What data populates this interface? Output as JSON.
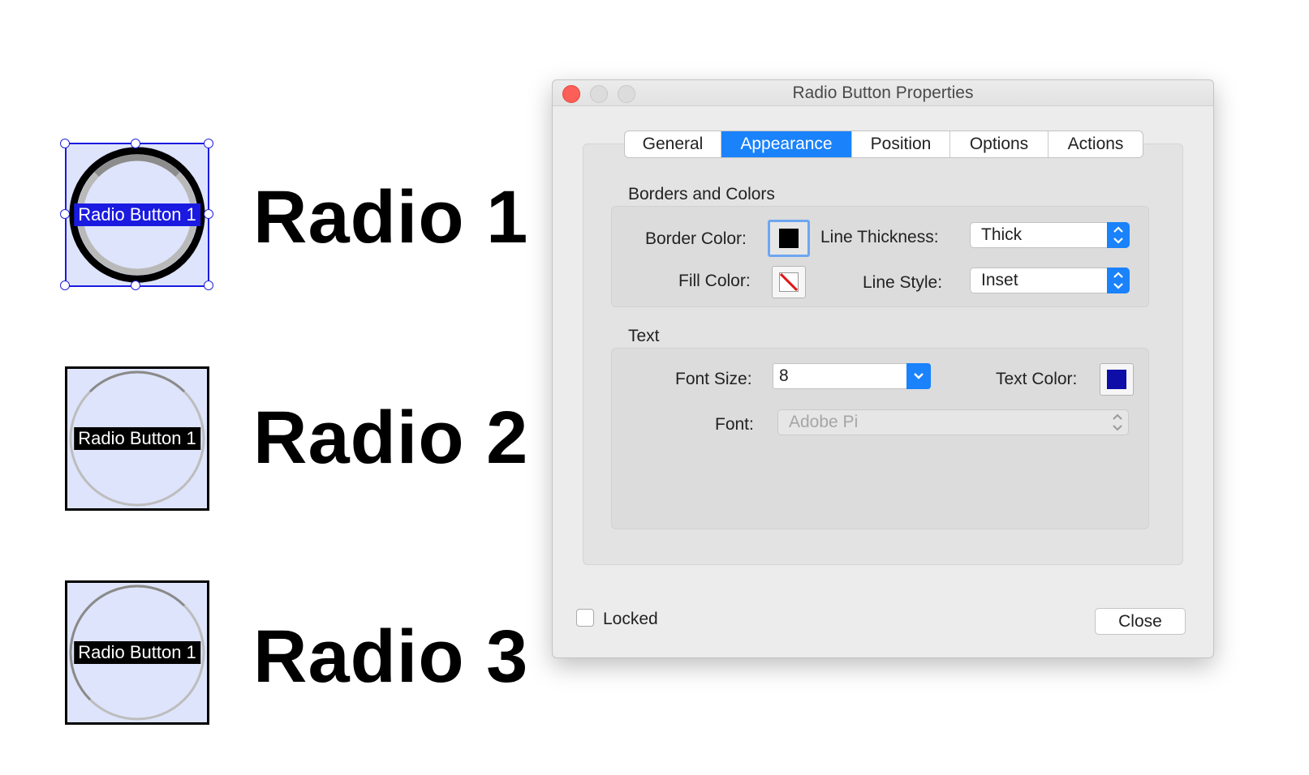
{
  "canvas": {
    "fields": [
      {
        "caption": "Radio Button 1",
        "heading": "Radio 1"
      },
      {
        "caption": "Radio Button 1",
        "heading": "Radio 2"
      },
      {
        "caption": "Radio Button 1",
        "heading": "Radio 3"
      }
    ]
  },
  "dialog": {
    "title": "Radio Button Properties",
    "tabs": [
      "General",
      "Appearance",
      "Position",
      "Options",
      "Actions"
    ],
    "active_tab": "Appearance",
    "borders_section": {
      "title": "Borders and Colors",
      "border_color_label": "Border Color:",
      "line_thickness_label": "Line Thickness:",
      "line_thickness_value": "Thick",
      "fill_color_label": "Fill Color:",
      "line_style_label": "Line Style:",
      "line_style_value": "Inset"
    },
    "text_section": {
      "title": "Text",
      "font_size_label": "Font Size:",
      "font_size_value": "8",
      "text_color_label": "Text Color:",
      "font_label": "Font:",
      "font_value": "Adobe Pi"
    },
    "locked_label": "Locked",
    "close_label": "Close"
  },
  "colors": {
    "accent": "#1a82fb",
    "border_color": "#000000",
    "text_color": "#0d0da8",
    "field_fill": "#dee4fb",
    "selection": "#1a1ae0"
  }
}
